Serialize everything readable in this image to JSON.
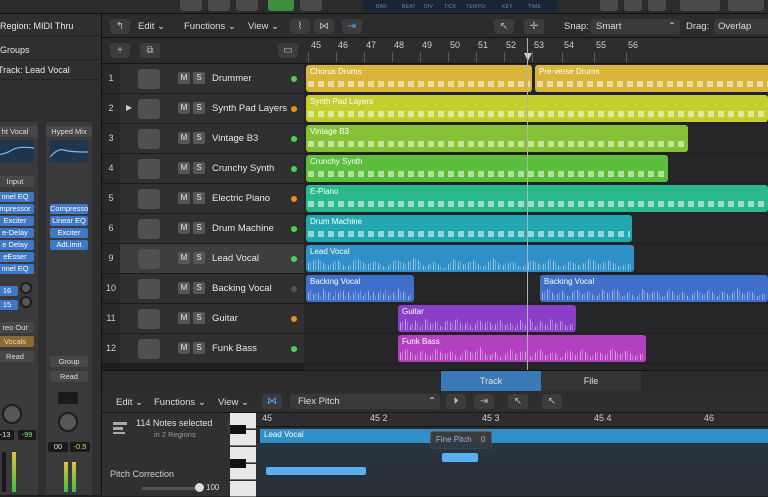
{
  "inspector": {
    "region_label": "Region: MIDI Thru",
    "groups_label": "Groups",
    "track_label": "Track: Lead Vocal",
    "left_strip": {
      "eq_label": "ht Vocal",
      "input_label": "Input",
      "plugins": [
        "nnel EQ",
        "mpressor",
        "Exciter",
        "e-Delay",
        "e Delay",
        "eEsser",
        "nnel EQ"
      ],
      "send1": "16",
      "send2": "15",
      "output": "reo Out",
      "group": "Vocals",
      "automation": "Read",
      "vol": "-13",
      "pan": "-99"
    },
    "right_strip": {
      "eq_label": "Hyped Mix",
      "plugins": [
        "Compressor",
        "Linear EQ",
        "Exciter",
        "AdLimit"
      ],
      "group": "Group",
      "automation": "Read",
      "vol": "00",
      "pan": "-0.5"
    }
  },
  "toolbar": {
    "edit": "Edit",
    "functions": "Functions",
    "view": "View",
    "snap_label": "Snap:",
    "snap_value": "Smart",
    "drag_label": "Drag:",
    "drag_value": "Overlap"
  },
  "lcd": {
    "labels": [
      "BAR",
      "BEAT",
      "DIV",
      "TICK",
      "TEMPO",
      "KEY",
      "TIME"
    ]
  },
  "ruler": {
    "bars": [
      "45",
      "46",
      "47",
      "48",
      "49",
      "50",
      "51",
      "52",
      "53",
      "54",
      "55",
      "56"
    ]
  },
  "tracks": [
    {
      "num": "1",
      "name": "Drummer",
      "led": "#4fd14f"
    },
    {
      "num": "2",
      "name": "Synth Pad Layers",
      "led": "#f08a24"
    },
    {
      "num": "3",
      "name": "Vintage B3",
      "led": "#4fd14f"
    },
    {
      "num": "4",
      "name": "Crunchy Synth",
      "led": "#4fd14f"
    },
    {
      "num": "5",
      "name": "Electric Piano",
      "led": "#f08a24"
    },
    {
      "num": "6",
      "name": "Drum Machine",
      "led": "#4fd14f"
    },
    {
      "num": "9",
      "name": "Lead Vocal",
      "led": "#4fd14f"
    },
    {
      "num": "10",
      "name": "Backing Vocal",
      "led": "#555555"
    },
    {
      "num": "11",
      "name": "Guitar",
      "led": "#f08a24"
    },
    {
      "num": "12",
      "name": "Funk Bass",
      "led": "#4fd14f"
    }
  ],
  "ms": {
    "m": "M",
    "s": "S"
  },
  "regions": [
    {
      "lane": 0,
      "name": "Chorus Drums",
      "color": "#d9b53a",
      "kind": "midi"
    },
    {
      "lane": 0,
      "name": "Pre-verse Drums",
      "color": "#d9b53a",
      "kind": "midi"
    },
    {
      "lane": 1,
      "name": "Synth Pad Layers",
      "color": "#c3cf2e",
      "kind": "midi"
    },
    {
      "lane": 2,
      "name": "Vintage B3",
      "color": "#86c236",
      "kind": "midi"
    },
    {
      "lane": 3,
      "name": "Crunchy Synth",
      "color": "#5dbe3e",
      "kind": "midi"
    },
    {
      "lane": 4,
      "name": "E-Piano",
      "color": "#2bb88c",
      "kind": "midi"
    },
    {
      "lane": 5,
      "name": "Drum Machine",
      "color": "#22a8b0",
      "kind": "midi"
    },
    {
      "lane": 6,
      "name": "Lead Vocal",
      "color": "#2f8fc9",
      "kind": "audio"
    },
    {
      "lane": 7,
      "name": "Backing Vocal",
      "color": "#3d6fcb",
      "kind": "audio"
    },
    {
      "lane": 7,
      "name": "Backing Vocal",
      "color": "#3d6fcb",
      "kind": "audio"
    },
    {
      "lane": 8,
      "name": "Guitar",
      "color": "#8a3fc8",
      "kind": "audio"
    },
    {
      "lane": 9,
      "name": "Funk Bass",
      "color": "#b43fc0",
      "kind": "audio"
    }
  ],
  "editor": {
    "tab_track": "Track",
    "tab_file": "File",
    "edit": "Edit",
    "functions": "Functions",
    "view": "View",
    "mode": "Flex Pitch",
    "notes_selected": "114 Notes selected",
    "in_regions": "in 2 Regions",
    "pitch_correction": "Pitch Correction",
    "pitch_value": "100",
    "ruler": [
      "45",
      "45 2",
      "45 3",
      "45 4",
      "46"
    ],
    "region_name": "Lead Vocal",
    "tooltip": "Fine Pitch",
    "tooltip_value": "0"
  }
}
